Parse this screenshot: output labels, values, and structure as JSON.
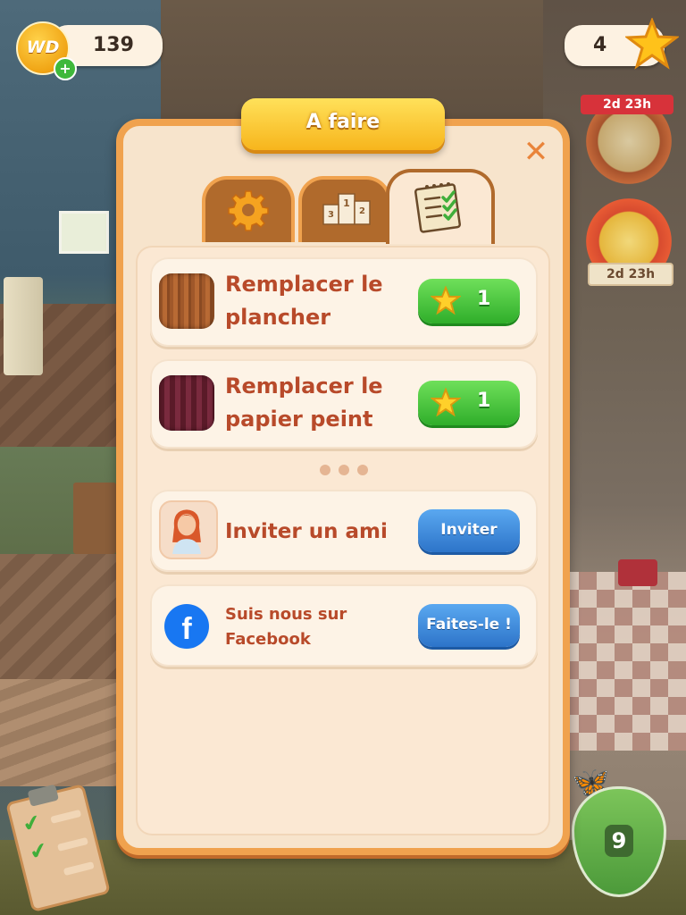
{
  "hud": {
    "currency_badge": "WD",
    "coins": "139",
    "stars": "4",
    "event1_timer": "2d 23h",
    "event2_timer": "2d 23h",
    "level": "9"
  },
  "panel": {
    "title": "A faire",
    "tabs": [
      {
        "name": "settings",
        "icon": "gear-icon"
      },
      {
        "name": "leaderboard",
        "icon": "podium-icon"
      },
      {
        "name": "tasks",
        "icon": "tasklist-icon",
        "active": true
      }
    ],
    "tasks": [
      {
        "title_line1": "Remplacer le",
        "title_line2": "plancher",
        "reward": "1"
      },
      {
        "title_line1": "Remplacer le",
        "title_line2": "papier peint",
        "reward": "1"
      }
    ],
    "invite": {
      "label": "Inviter un ami",
      "button": "Inviter"
    },
    "facebook": {
      "line1": "Suis nous sur",
      "line2": "Facebook",
      "button": "Faites-le !"
    }
  },
  "colors": {
    "panel_border": "#f0a24e",
    "title_banner": "#f7b51c",
    "green_button": "#2fae2a",
    "blue_button": "#2d74c9",
    "task_text": "#b84a2a"
  }
}
